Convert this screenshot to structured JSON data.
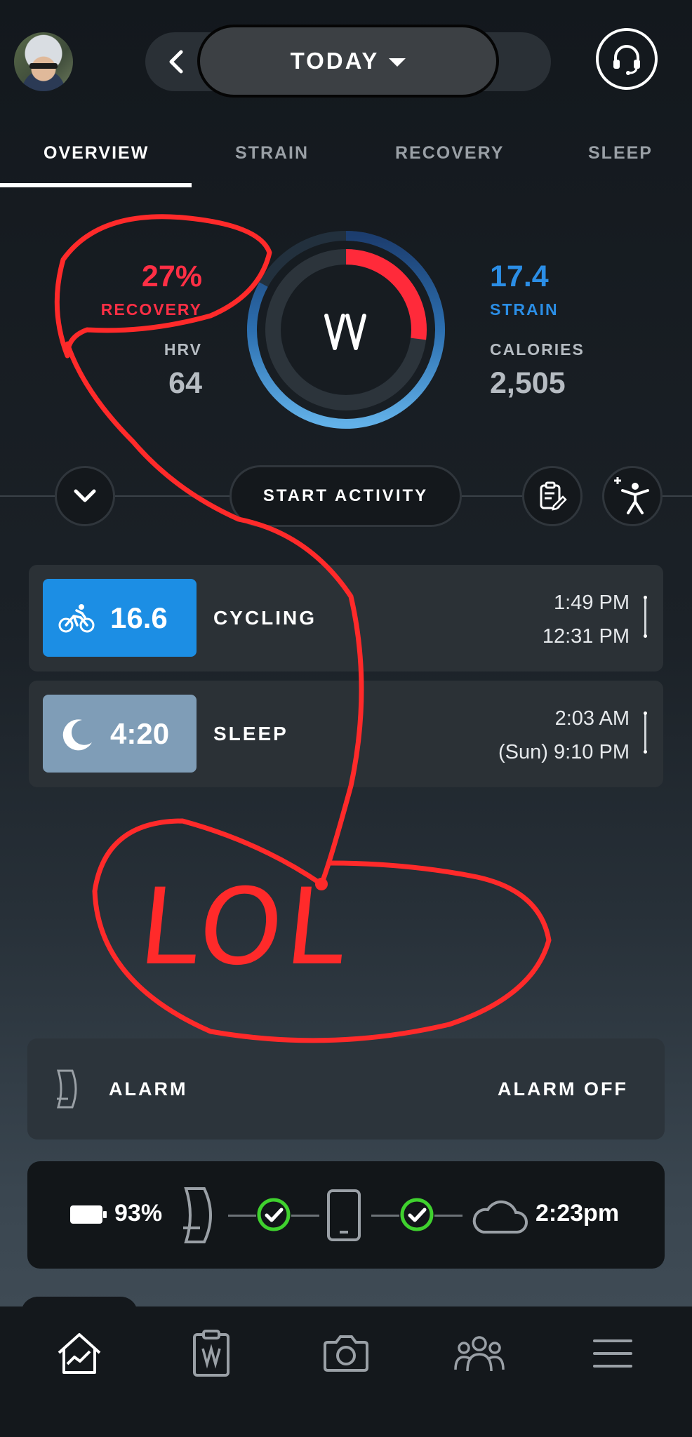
{
  "header": {
    "date_label": "TODAY"
  },
  "tabs": [
    {
      "label": "OVERVIEW",
      "active": true
    },
    {
      "label": "STRAIN",
      "active": false
    },
    {
      "label": "RECOVERY",
      "active": false
    },
    {
      "label": "SLEEP",
      "active": false
    }
  ],
  "stats": {
    "recovery_value": "27%",
    "recovery_label": "RECOVERY",
    "hrv_label": "HRV",
    "hrv_value": "64",
    "strain_value": "17.4",
    "strain_label": "STRAIN",
    "calories_label": "CALORIES",
    "calories_value": "2,505",
    "recovery_fraction": 0.27,
    "strain_fraction": 0.83
  },
  "actions": {
    "start_label": "START ACTIVITY"
  },
  "activities": [
    {
      "value": "16.6",
      "name": "CYCLING",
      "end_time": "1:49 PM",
      "start_time": "12:31 PM",
      "icon": "cyclist-icon",
      "color": "#1c8ee4"
    },
    {
      "value": "4:20",
      "name": "SLEEP",
      "end_time": "2:03 AM",
      "start_time": "(Sun) 9:10 PM",
      "icon": "moon-icon",
      "color": "#7f9db7"
    }
  ],
  "alarm": {
    "label": "ALARM",
    "status": "ALARM OFF"
  },
  "device_status": {
    "battery": "93%",
    "last_sync": "2:23pm"
  },
  "annotation": {
    "text": "LOL"
  },
  "colors": {
    "recovery_red": "#ff2f45",
    "strain_blue": "#2b8ee6",
    "check_green": "#3fd12e",
    "annotation_red": "#ff2a2a"
  }
}
